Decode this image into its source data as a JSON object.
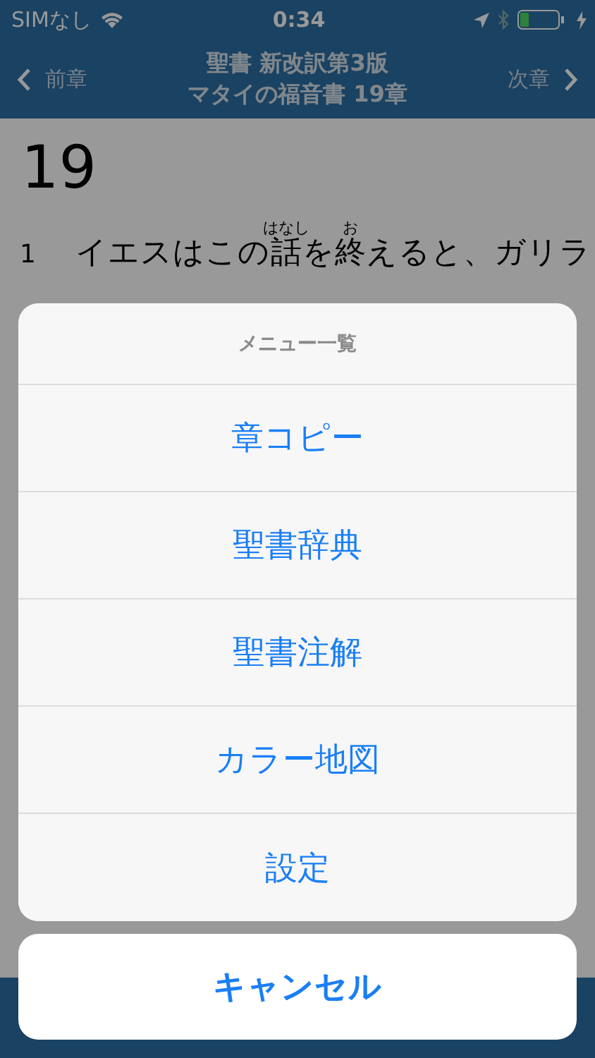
{
  "status_bar": {
    "carrier": "SIMなし",
    "time": "0:34"
  },
  "nav": {
    "back": "前章",
    "title": "聖書 新改訳第3版",
    "subtitle": "マタイの福音書 19章",
    "forward": "次章"
  },
  "chapter": "19",
  "verse": {
    "number": "1",
    "segments": [
      {
        "text": "イエスはこの"
      },
      {
        "text": "話",
        "ruby": "はなし"
      },
      {
        "text": "を"
      },
      {
        "text": "終",
        "ruby": "お"
      },
      {
        "text": "えると、ガリラ"
      }
    ]
  },
  "action_sheet": {
    "title": "メニュー一覧",
    "items": [
      "章コピー",
      "聖書辞典",
      "聖書注解",
      "カラー地図",
      "設定"
    ],
    "cancel": "キャンセル"
  }
}
